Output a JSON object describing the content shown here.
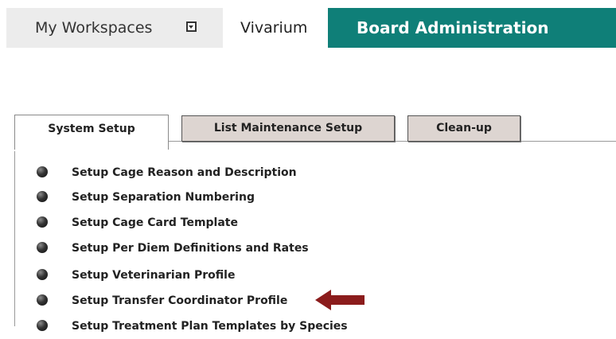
{
  "top_nav": {
    "workspaces_label": "My Workspaces",
    "vivarium_label": "Vivarium",
    "board_admin_label": "Board Administration"
  },
  "sub_tabs": [
    {
      "label": "System Setup",
      "active": true
    },
    {
      "label": "List Maintenance Setup",
      "active": false
    },
    {
      "label": "Clean-up",
      "active": false
    }
  ],
  "menu": {
    "items": [
      {
        "label": "Setup Cage Reason and Description"
      },
      {
        "label": "Setup Separation Numbering"
      },
      {
        "label": "Setup Cage Card Template"
      },
      {
        "label": "Setup Per Diem Definitions and Rates"
      },
      {
        "label": "Setup Veterinarian Profile"
      },
      {
        "label": "Setup Transfer Coordinator Profile"
      },
      {
        "label": "Setup Treatment Plan Templates by Species"
      }
    ]
  },
  "colors": {
    "board_admin_bg": "#0f7f78",
    "inactive_tab_bg": "#ddd5d1",
    "arrow": "#8b1c1c"
  }
}
